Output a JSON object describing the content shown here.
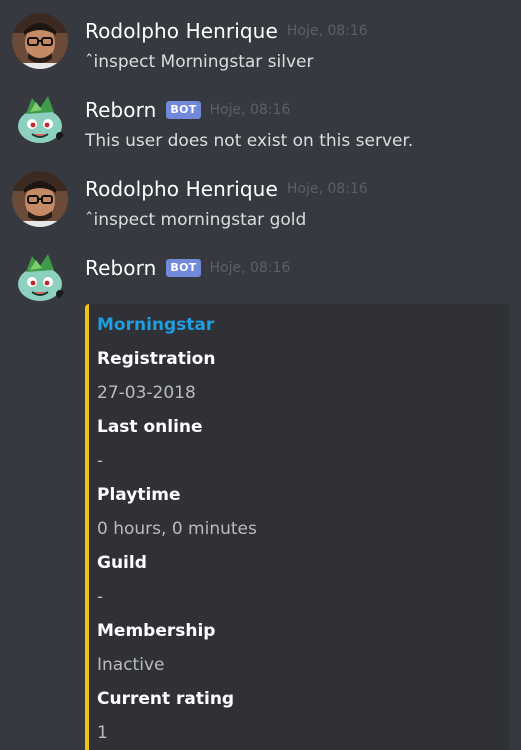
{
  "messages": [
    {
      "author": "Rodolpho Henrique",
      "timestamp": "Hoje, 08:16",
      "text": "ˆinspect Morningstar silver",
      "avatar": "user-photo-avatar"
    },
    {
      "author": "Reborn",
      "bot_tag": "BOT",
      "timestamp": "Hoje, 08:16",
      "text": "This user does not exist on this server.",
      "avatar": "bulbasaur-avatar"
    },
    {
      "author": "Rodolpho Henrique",
      "timestamp": "Hoje, 08:16",
      "text": "ˆinspect morningstar gold",
      "avatar": "user-photo-avatar"
    },
    {
      "author": "Reborn",
      "bot_tag": "BOT",
      "timestamp": "Hoje, 08:16",
      "avatar": "bulbasaur-avatar"
    }
  ],
  "embed": {
    "accent_color": "#f1c40f",
    "title": "Morningstar",
    "fields": [
      {
        "name": "Registration",
        "value": "27-03-2018"
      },
      {
        "name": "Last online",
        "value": "-"
      },
      {
        "name": "Playtime",
        "value": "0 hours, 0 minutes"
      },
      {
        "name": "Guild",
        "value": "-"
      },
      {
        "name": "Membership",
        "value": "Inactive"
      },
      {
        "name": "Current rating",
        "value": "1"
      }
    ]
  }
}
